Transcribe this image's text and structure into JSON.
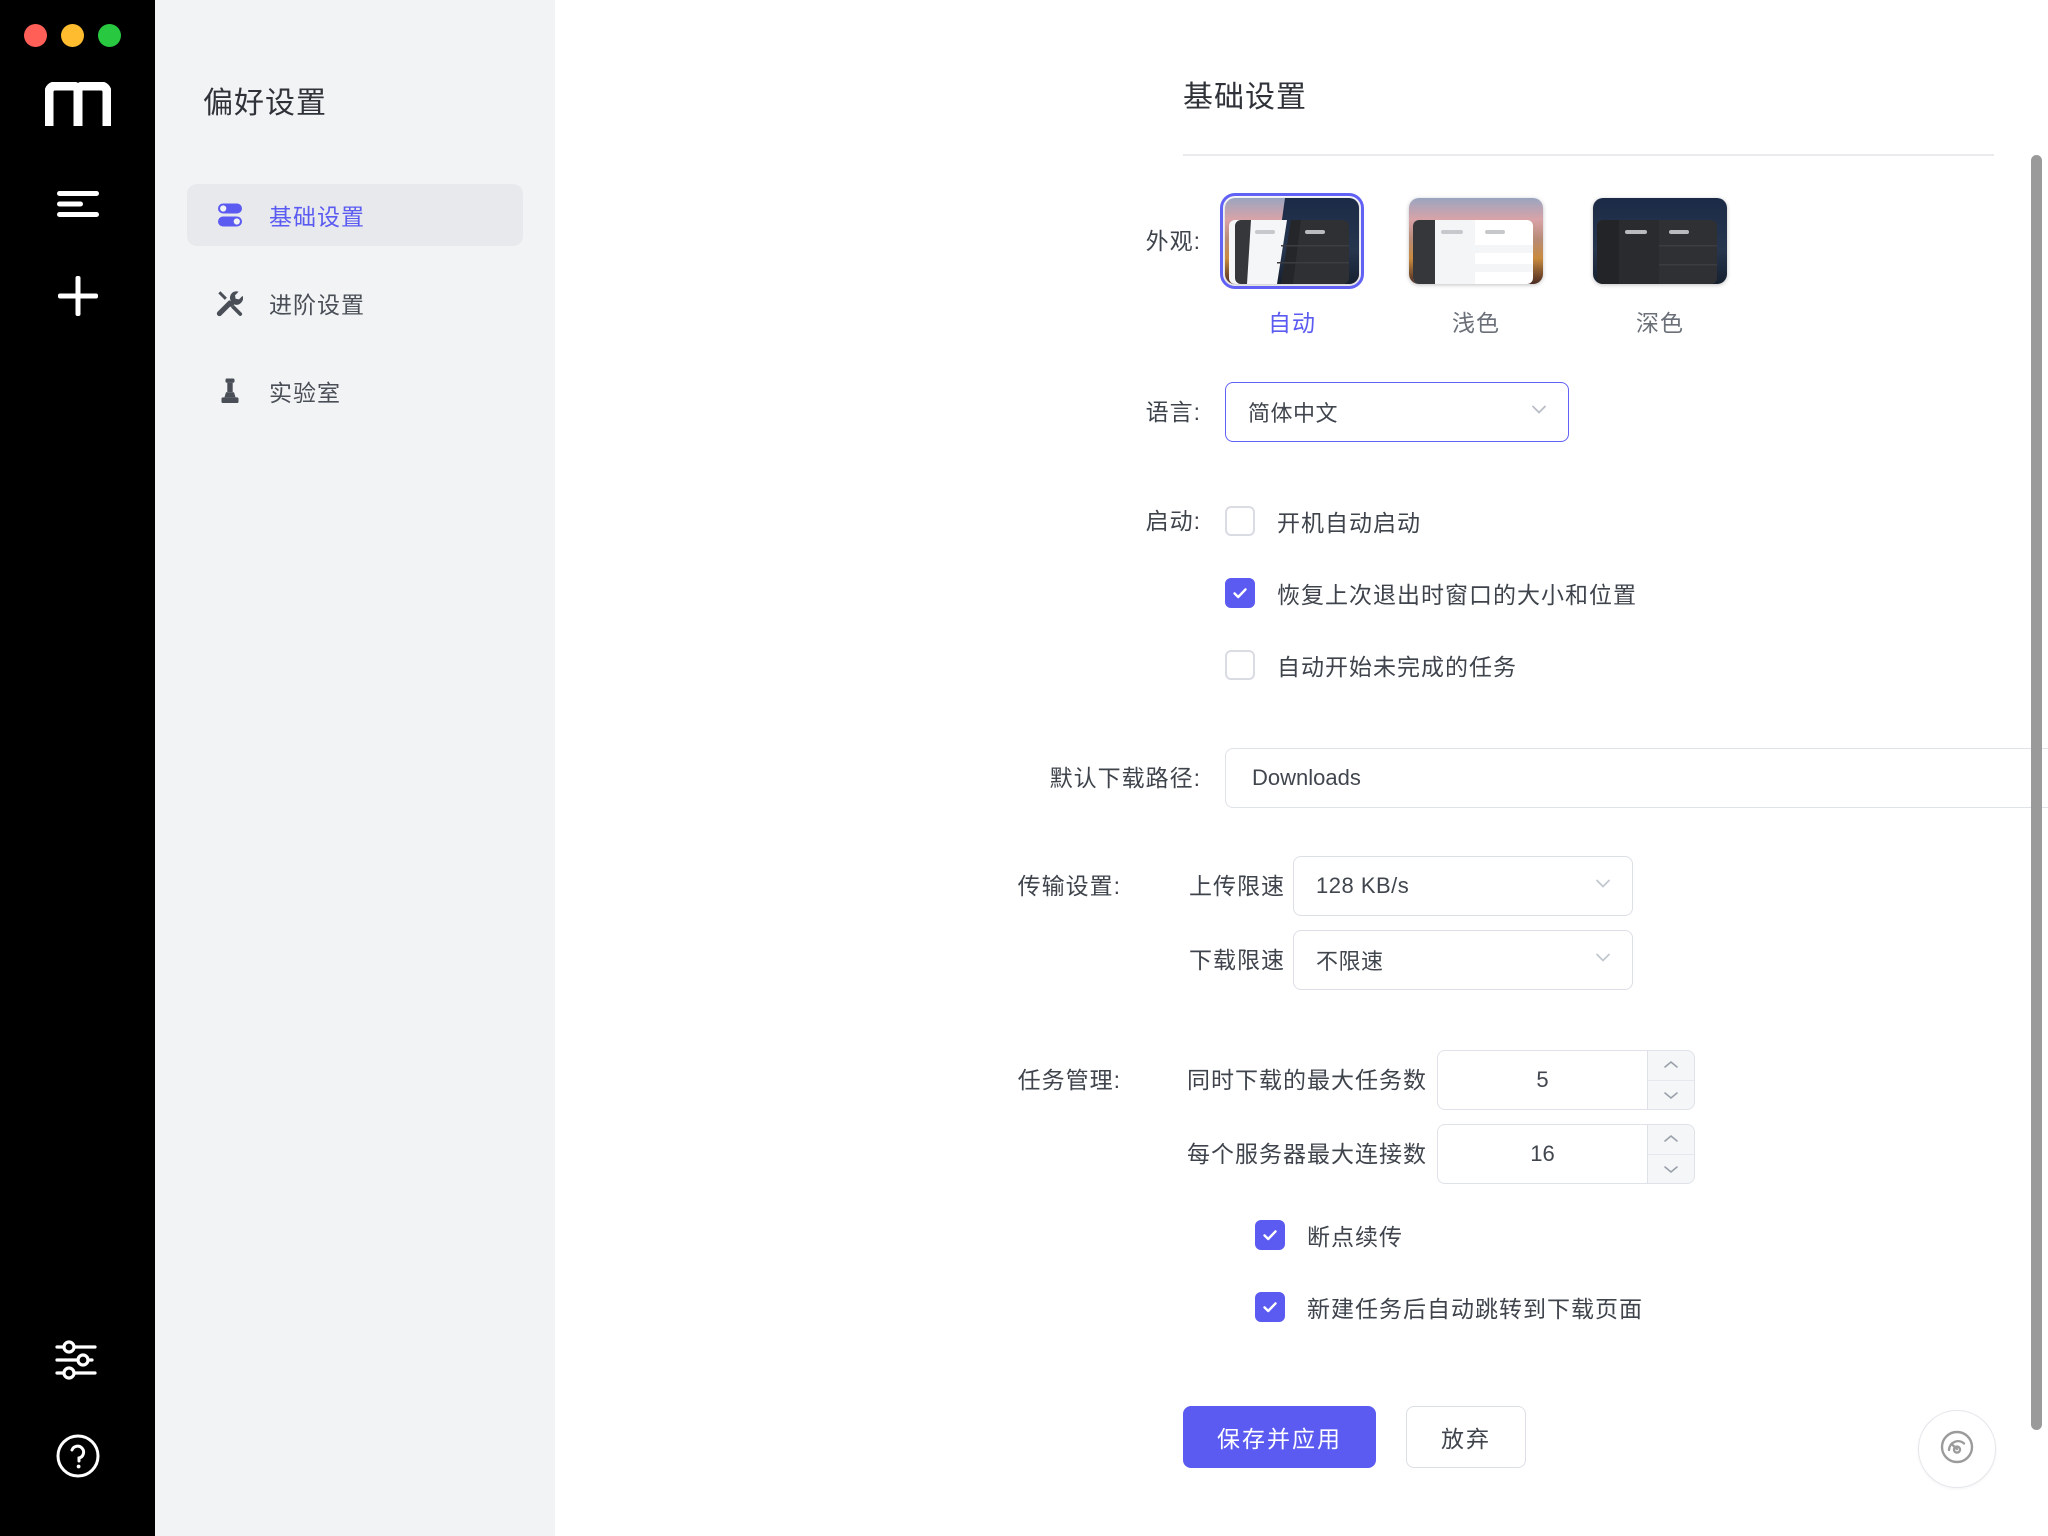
{
  "window": {
    "traffic_lights": [
      "close",
      "minimize",
      "maximize"
    ],
    "brand_logo": "motrix-m-logo"
  },
  "rail": {
    "items": [
      {
        "name": "task-list",
        "icon": "task-list-icon"
      },
      {
        "name": "add-task",
        "icon": "plus-icon"
      }
    ],
    "bottom_items": [
      {
        "name": "preferences",
        "icon": "sliders-icon"
      },
      {
        "name": "help",
        "icon": "question-circle-icon"
      }
    ]
  },
  "sidebar": {
    "title": "偏好设置",
    "items": [
      {
        "label": "基础设置",
        "icon": "toggles-icon",
        "active": true
      },
      {
        "label": "进阶设置",
        "icon": "tools-icon",
        "active": false
      },
      {
        "label": "实验室",
        "icon": "chess-pawn-icon",
        "active": false
      }
    ]
  },
  "main": {
    "title": "基础设置",
    "appearance": {
      "label": "外观:",
      "options": [
        {
          "name": "自动",
          "value": "auto",
          "selected": true
        },
        {
          "name": "浅色",
          "value": "light",
          "selected": false
        },
        {
          "name": "深色",
          "value": "dark",
          "selected": false
        }
      ]
    },
    "language": {
      "label": "语言:",
      "value": "简体中文"
    },
    "startup": {
      "label": "启动:",
      "options": [
        {
          "label": "开机自动启动",
          "checked": false
        },
        {
          "label": "恢复上次退出时窗口的大小和位置",
          "checked": true
        },
        {
          "label": "自动开始未完成的任务",
          "checked": false
        }
      ]
    },
    "download_path": {
      "label": "默认下载路径:",
      "value": "Downloads",
      "browse_icon": "folder-icon"
    },
    "transfer": {
      "label": "传输设置:",
      "upload": {
        "label": "上传限速",
        "value": "128 KB/s"
      },
      "download": {
        "label": "下载限速",
        "value": "不限速"
      }
    },
    "task_management": {
      "label": "任务管理:",
      "max_concurrent": {
        "label": "同时下载的最大任务数",
        "value": "5"
      },
      "max_connections": {
        "label": "每个服务器最大连接数",
        "value": "16"
      },
      "checkboxes": [
        {
          "label": "断点续传",
          "checked": true
        },
        {
          "label": "新建任务后自动跳转到下载页面",
          "checked": true
        }
      ]
    },
    "actions": {
      "save": "保存并应用",
      "discard": "放弃"
    },
    "fab": {
      "icon": "speedometer-icon"
    }
  },
  "colors": {
    "accent": "#5b5bf2",
    "rail_bg": "#000000",
    "sidebar_bg": "#f2f3f5",
    "main_bg": "#ffffff",
    "text": "#3f444c"
  }
}
